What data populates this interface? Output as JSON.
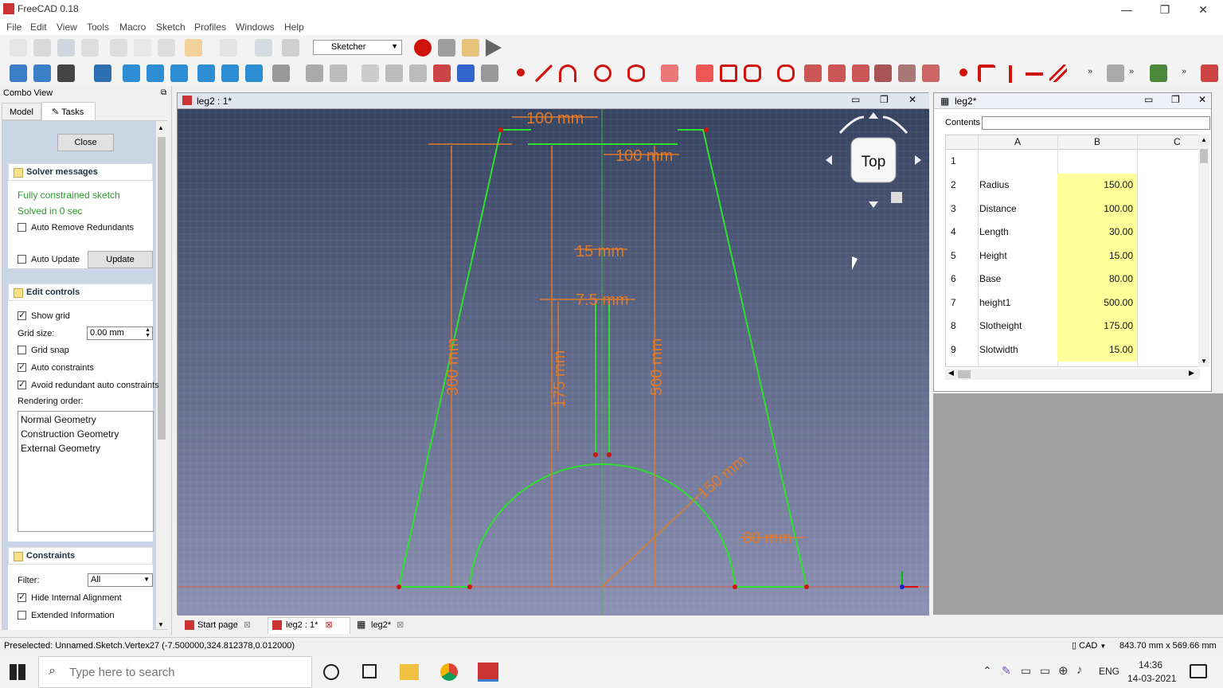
{
  "app": {
    "title": "FreeCAD 0.18",
    "accent": "#c33"
  },
  "menu": [
    "File",
    "Edit",
    "View",
    "Tools",
    "Macro",
    "Sketch",
    "Profiles",
    "Windows",
    "Help"
  ],
  "workbench": {
    "selected": "Sketcher"
  },
  "combo": {
    "title": "Combo View",
    "tabs": [
      "Model",
      "Tasks"
    ],
    "close_label": "Close",
    "solver": {
      "header": "Solver messages",
      "line1": "Fully constrained sketch",
      "line2": "Solved in 0 sec",
      "auto_remove": "Auto Remove Redundants",
      "auto_update": "Auto Update",
      "update_btn": "Update"
    },
    "edit": {
      "header": "Edit controls",
      "show_grid": "Show grid",
      "grid_size_label": "Grid size:",
      "grid_size_value": "0.00 mm",
      "grid_snap": "Grid snap",
      "auto_constraints": "Auto constraints",
      "avoid_redundant": "Avoid redundant auto constraints",
      "rendering_order": "Rendering order:",
      "order": [
        "Normal Geometry",
        "Construction Geometry",
        "External Geometry"
      ]
    },
    "constraints": {
      "header": "Constraints",
      "filter_label": "Filter:",
      "filter_value": "All",
      "hide_internal": "Hide Internal Alignment",
      "extended_info": "Extended Information"
    }
  },
  "sketch": {
    "tab_title": "leg2 : 1*",
    "nav_cube": "Top",
    "dims": [
      "100 mm",
      "100 mm",
      "15 mm",
      "7.5 mm",
      "300 mm",
      "175 mm",
      "500 mm",
      "150 mm",
      "80 mm"
    ]
  },
  "sheet": {
    "title": "leg2*",
    "contents_label": "Contents",
    "cols": [
      "A",
      "B",
      "C"
    ],
    "rows": [
      {
        "n": "1",
        "a": "",
        "b": ""
      },
      {
        "n": "2",
        "a": "Radius",
        "b": "150.00"
      },
      {
        "n": "3",
        "a": "Distance",
        "b": "100.00"
      },
      {
        "n": "4",
        "a": "Length",
        "b": "30.00"
      },
      {
        "n": "5",
        "a": "Height",
        "b": "15.00"
      },
      {
        "n": "6",
        "a": "Base",
        "b": "80.00"
      },
      {
        "n": "7",
        "a": "height1",
        "b": "500.00"
      },
      {
        "n": "8",
        "a": "Slotheight",
        "b": "175.00"
      },
      {
        "n": "9",
        "a": "Slotwidth",
        "b": "15.00"
      }
    ]
  },
  "doc_tabs": [
    "Start page",
    "leg2 : 1*",
    "leg2*"
  ],
  "status": {
    "text": "Preselected: Unnamed.Sketch.Vertex27 (-7.500000,324.812378,0.012000)",
    "nav": "CAD",
    "dims": "843.70 mm x 569.66 mm"
  },
  "taskbar": {
    "search_placeholder": "Type here to search",
    "lang": "ENG",
    "time": "14:36",
    "date": "14-03-2021"
  }
}
